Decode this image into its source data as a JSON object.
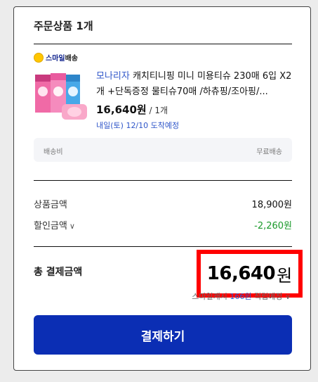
{
  "order": {
    "title": "주문상품 1개",
    "shipping_badge": {
      "prefix": "스마일",
      "suffix": "배송"
    },
    "product": {
      "brand": "모나리자",
      "name_rest": " 캐치티니핑 미니 미용티슈 230매 6입 X2개 +단독증정 물티슈70매 /하츄핑/조아핑/...",
      "price": "16,640원",
      "quantity": " / 1개",
      "delivery_estimate": "내일(토) 12/10 도착예정"
    },
    "shipping_fee": {
      "label": "배송비",
      "value": "무료배송"
    }
  },
  "summary": {
    "product_amount": {
      "label": "상품금액",
      "value": "18,900원"
    },
    "discount_amount": {
      "label": "할인금액",
      "value": "-2,260원"
    },
    "total": {
      "label": "총 결제금액",
      "number": "16,640",
      "unit": "원"
    },
    "smile_cash": {
      "prefix": "스마일캐시 ",
      "amount": "166원",
      "suffix": " 적립예정 ∨"
    }
  },
  "pay_button": "결제하기",
  "colors": {
    "brand_blue": "#0b2eb4",
    "highlight_red": "#ff0000",
    "discount_green": "#1a9a2a"
  }
}
